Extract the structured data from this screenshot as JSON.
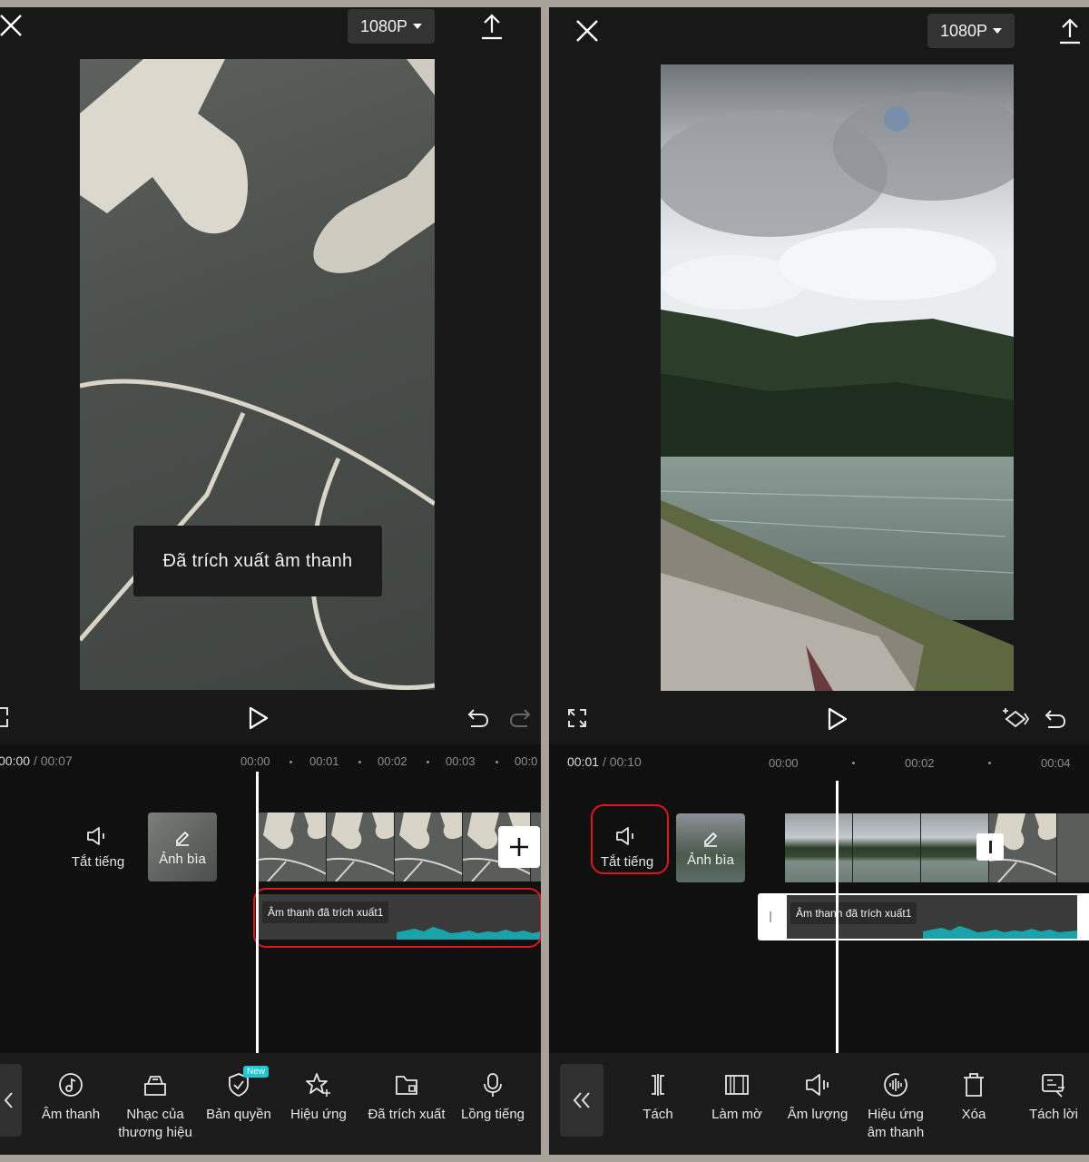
{
  "left": {
    "resolution": "1080P",
    "toast": "Đã trích xuất âm thanh",
    "time_current": "00:00",
    "time_total": "00:07",
    "ruler": [
      "00:00",
      "00:01",
      "00:02",
      "00:03",
      "00:0"
    ],
    "mute_label": "Tắt tiếng",
    "cover_label": "Ảnh bìa",
    "audio_label": "Âm thanh đã trích xuất1",
    "new_badge": "New",
    "tools": [
      "Âm thanh",
      "Nhạc của thương hiệu",
      "Bản quyền",
      "Hiệu ứng",
      "Đã trích xuất",
      "Lồng tiếng"
    ]
  },
  "right": {
    "resolution": "1080P",
    "time_current": "00:01",
    "time_total": "00:10",
    "ruler": [
      "00:00",
      "00:02",
      "00:04"
    ],
    "mute_label": "Tắt tiếng",
    "cover_label": "Ảnh bìa",
    "audio_label": "Âm thanh đã trích xuất1",
    "tools": [
      "Tách",
      "Làm mờ",
      "Âm lượng",
      "Hiệu ứng âm thanh",
      "Xóa",
      "Tách lời"
    ]
  },
  "icons": [
    "close-icon",
    "caret-down-icon",
    "export-icon",
    "fullscreen-icon",
    "play-icon",
    "undo-icon",
    "redo-icon",
    "keyframe-icon",
    "speaker-icon",
    "edit-icon",
    "plus-icon",
    "music-icon",
    "brand-music-icon",
    "copyright-icon",
    "effects-icon",
    "folder-icon",
    "microphone-icon",
    "back-icon",
    "split-icon",
    "fade-icon",
    "volume-icon",
    "sound-effect-icon",
    "delete-icon",
    "captions-icon"
  ],
  "colors": {
    "highlight": "#e0141b",
    "waveform": "#1aa3a8",
    "badge": "#1fc6d4"
  }
}
